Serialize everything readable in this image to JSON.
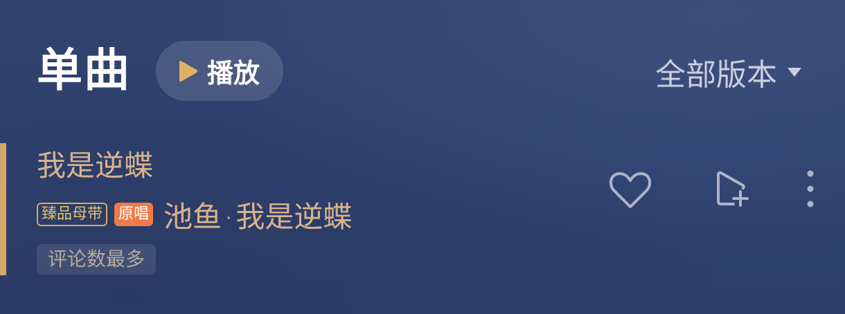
{
  "header": {
    "section_title": "单曲",
    "play_all_label": "播放",
    "version_filter_label": "全部版本"
  },
  "song": {
    "title": "我是逆蝶",
    "quality_badge": "臻品母带",
    "original_badge": "原唱",
    "artist": "池鱼",
    "separator": "·",
    "album": "我是逆蝶",
    "tag": "评论数最多"
  },
  "icons": {
    "play": "play-icon",
    "dropdown": "chevron-down-icon",
    "like": "heart-icon",
    "add_to_playlist": "add-to-playlist-icon",
    "more": "more-vertical-icon"
  },
  "colors": {
    "background": "#2f4170",
    "accent_gold": "#d7a668",
    "song_text": "#d8b48b",
    "play_triangle": "#e2b165",
    "original_badge": "#f07b48",
    "quality_badge": "#d9ad58"
  }
}
